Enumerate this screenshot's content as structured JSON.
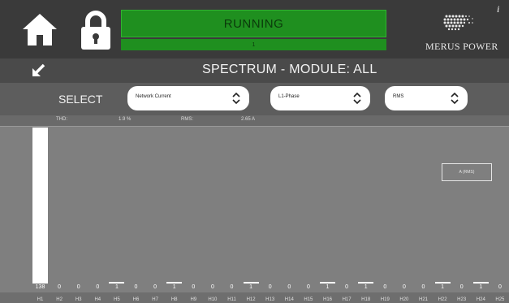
{
  "status": {
    "main": "RUNNING",
    "sub": "1"
  },
  "logo": {
    "text": "MERUS POWER"
  },
  "info_icon": "i",
  "title": "SPECTRUM - MODULE: ALL",
  "select": {
    "label": "SELECT",
    "dropdowns": [
      {
        "value": "Network Current"
      },
      {
        "value": "L1-Phase"
      },
      {
        "value": "RMS"
      }
    ]
  },
  "info": {
    "thd_label": "THD:",
    "thd_value": "1.9 %",
    "rms_label": "RMS:",
    "rms_value": "2.65 A"
  },
  "legend": "A (RMS)",
  "chart_data": {
    "type": "bar",
    "categories": [
      "H1",
      "H2",
      "H3",
      "H4",
      "H5",
      "H6",
      "H7",
      "H8",
      "H9",
      "H10",
      "H11",
      "H12",
      "H13",
      "H14",
      "H15",
      "H16",
      "H17",
      "H18",
      "H19",
      "H20",
      "H21",
      "H22",
      "H23",
      "H24",
      "H25"
    ],
    "values": [
      138,
      0,
      0,
      0,
      1,
      0,
      0,
      1,
      0,
      0,
      0,
      1,
      0,
      0,
      0,
      1,
      0,
      1,
      0,
      0,
      0,
      1,
      0,
      1,
      0,
      0
    ],
    "value_labels": [
      "138",
      "0",
      "0",
      "0",
      "1",
      "0",
      "0",
      "1",
      "0",
      "0",
      "0",
      "1",
      "0",
      "0",
      "0",
      "1",
      "0",
      "1",
      "0",
      "0",
      "0",
      "1",
      "0",
      "1",
      "0",
      "0"
    ],
    "ymax": 138
  }
}
